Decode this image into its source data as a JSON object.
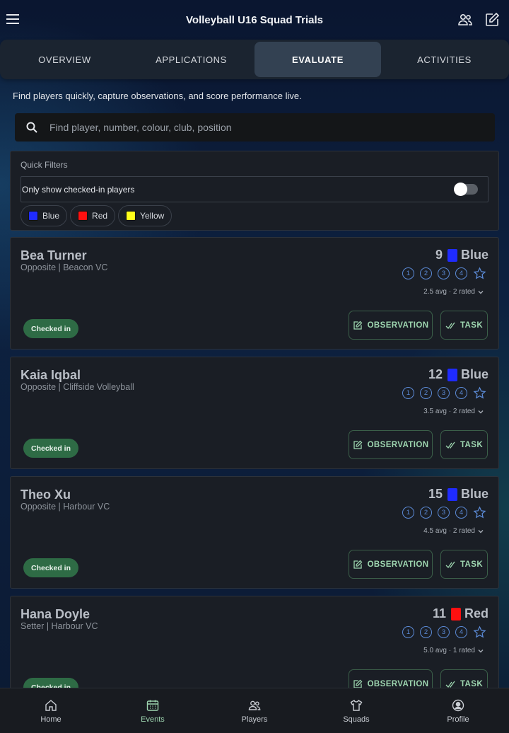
{
  "header": {
    "title": "Volleyball U16 Squad Trials"
  },
  "tabs": [
    {
      "label": "OVERVIEW",
      "active": false
    },
    {
      "label": "APPLICATIONS",
      "active": false
    },
    {
      "label": "EVALUATE",
      "active": true
    },
    {
      "label": "ACTIVITIES",
      "active": false
    }
  ],
  "subtitle": "Find players quickly, capture observations, and score performance live.",
  "search": {
    "placeholder": "Find player, number, colour, club, position",
    "value": ""
  },
  "quick_filters": {
    "label": "Quick Filters",
    "toggle_label": "Only show checked-in players",
    "toggle_on": false,
    "chips": [
      {
        "label": "Blue",
        "color": "#1f2bff"
      },
      {
        "label": "Red",
        "color": "#ff1010"
      },
      {
        "label": "Yellow",
        "color": "#ffff1a"
      }
    ]
  },
  "rating_options": [
    "1",
    "2",
    "3",
    "4"
  ],
  "players": [
    {
      "name": "Bea Turner",
      "meta": "Opposite | Beacon VC",
      "number": "9",
      "colour": "Blue",
      "colour_hex": "#1f2bff",
      "avg": "2.5 avg · 2 rated",
      "status": "Checked in",
      "observation_label": "OBSERVATION",
      "task_label": "TASK"
    },
    {
      "name": "Kaia Iqbal",
      "meta": "Opposite | Cliffside Volleyball",
      "number": "12",
      "colour": "Blue",
      "colour_hex": "#1f2bff",
      "avg": "3.5 avg · 2 rated",
      "status": "Checked in",
      "observation_label": "OBSERVATION",
      "task_label": "TASK"
    },
    {
      "name": "Theo Xu",
      "meta": "Opposite | Harbour VC",
      "number": "15",
      "colour": "Blue",
      "colour_hex": "#1f2bff",
      "avg": "4.5 avg · 2 rated",
      "status": "Checked in",
      "observation_label": "OBSERVATION",
      "task_label": "TASK"
    },
    {
      "name": "Hana Doyle",
      "meta": "Setter | Harbour VC",
      "number": "11",
      "colour": "Red",
      "colour_hex": "#ff1010",
      "avg": "5.0 avg · 1 rated",
      "status": "Checked in",
      "observation_label": "OBSERVATION",
      "task_label": "TASK"
    }
  ],
  "bottom_nav": [
    {
      "label": "Home",
      "icon": "home-icon",
      "active": false
    },
    {
      "label": "Events",
      "icon": "calendar-icon",
      "active": true
    },
    {
      "label": "Players",
      "icon": "people-icon",
      "active": false
    },
    {
      "label": "Squads",
      "icon": "shirt-icon",
      "active": false
    },
    {
      "label": "Profile",
      "icon": "profile-icon",
      "active": false
    }
  ],
  "colors": {
    "accent_green": "#9ed6b0",
    "status_green": "#2e6b45",
    "rating_blue": "#5b8ad6"
  }
}
